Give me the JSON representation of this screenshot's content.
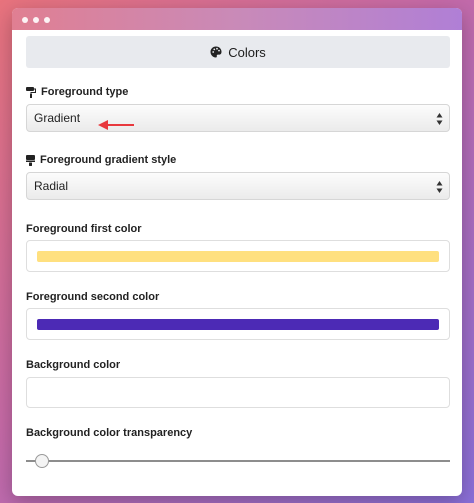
{
  "header": {
    "title": "Colors",
    "icon": "palette-icon"
  },
  "fields": {
    "fg_type": {
      "label": "Foreground type",
      "value": "Gradient"
    },
    "fg_gradient_style": {
      "label": "Foreground gradient style",
      "value": "Radial"
    },
    "fg_first_color": {
      "label": "Foreground first color",
      "color": "#ffe07f"
    },
    "fg_second_color": {
      "label": "Foreground second color",
      "color": "#4c2ab5"
    },
    "bg_color": {
      "label": "Background color"
    },
    "bg_transparency": {
      "label": "Background color transparency",
      "value": 0
    }
  },
  "colors": {
    "annotation_arrow": "#e8383d"
  }
}
